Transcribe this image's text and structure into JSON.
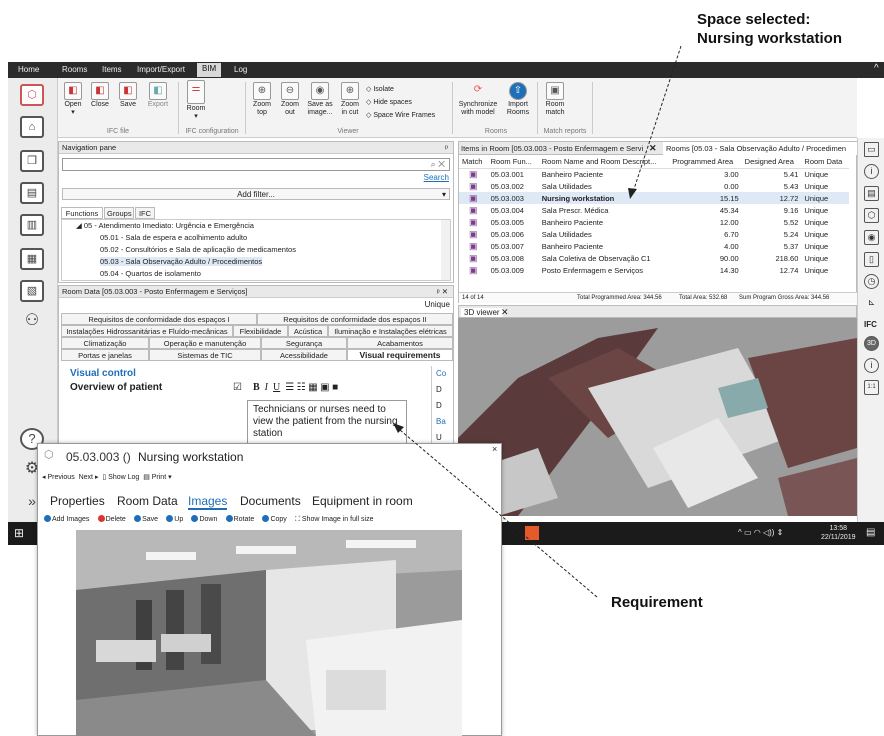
{
  "annotations": {
    "selected_line1": "Space selected:",
    "selected_line2": "Nursing workstation",
    "requirement": "Requirement"
  },
  "menubar": {
    "items": [
      "Home",
      "Rooms",
      "Items",
      "Import/Export",
      "BIM",
      "Log"
    ],
    "active": "BIM",
    "caret": "^"
  },
  "ribbon": {
    "buttons": [
      {
        "label": "Open",
        "sub": "▾"
      },
      {
        "label": "Close"
      },
      {
        "label": "Save"
      },
      {
        "label": "Export"
      },
      {
        "label": "Room",
        "sub": "▾"
      },
      {
        "label": "Zoom",
        "sub": "top"
      },
      {
        "label": "Zoom",
        "sub": "out"
      },
      {
        "label": "Save as",
        "sub": "image..."
      },
      {
        "label": "Zoom",
        "sub": "in cut"
      },
      {
        "label": "Synchronize",
        "sub": "with model"
      },
      {
        "label": "Import",
        "sub": "Rooms"
      },
      {
        "label": "Room",
        "sub": "match"
      }
    ],
    "checks": [
      "Isolate",
      "Hide spaces",
      "Space Wire Frames"
    ],
    "groups": [
      "IFC file",
      "IFC configuration",
      "Viewer",
      "Rooms",
      "Match reports"
    ]
  },
  "nav": {
    "title": "Navigation pane",
    "pin": "ᵖ",
    "search_link": "Search",
    "add_filter": "Add filter...",
    "tabs": [
      "Functions",
      "Groups",
      "IFC"
    ],
    "tree": [
      "05 - Atendimento Imediato: Urgência e Emergência",
      "05.01 - Sala de espera e acolhimento adulto",
      "05.02 - Consultórios e Sala de aplicação de medicamentos",
      "05.03 - Sala Observação Adulto / Procedimentos",
      "05.04 - Quartos de isolamento"
    ]
  },
  "roomdata": {
    "title": "Room Data [05.03.003 - Posto Enfermagem e Serviços]",
    "unique": "Unique",
    "tabs_r1": [
      "Requisitos de conformidade dos espaços I",
      "Requisitos de conformidade dos espaços II"
    ],
    "tabs_r2": [
      "Instalações Hidrossanitárias e Fluído-mecânicas",
      "Flexibilidade",
      "Acústica",
      "Iluminação e Instalações elétricas"
    ],
    "tabs_r3": [
      "Climatização",
      "Operação e manutenção",
      "Segurança",
      "Acabamentos"
    ],
    "tabs_r4": [
      "Portas e janelas",
      "Sistemas de TIC",
      "Acessibilidade",
      "Visual requirements"
    ],
    "section": "Visual control",
    "field": "Overview of patient",
    "editor_text": "Technicians or nurses need to view the patient from the nursing station",
    "side": [
      "Co",
      "D",
      "D",
      "Ba",
      "U"
    ]
  },
  "items_tab": "Items in Room [05.03.003 - Posto Enfermagem e Servi",
  "rooms_tab": "Rooms [05.03 - Sala Observação Adulto / Procedimen",
  "rooms": {
    "headers": [
      "Match",
      "Room Fun...",
      "Room Name and Room Descript...",
      "Programmed Area",
      "Designed Area",
      "Room Data"
    ],
    "rows": [
      [
        "05.03.001",
        "Banheiro Paciente",
        "3.00",
        "5.41",
        "Unique"
      ],
      [
        "05.03.002",
        "Sala Utilidades",
        "0.00",
        "5.43",
        "Unique"
      ],
      [
        "05.03.003",
        "Nursing workstation",
        "15.15",
        "12.72",
        "Unique"
      ],
      [
        "05.03.004",
        "Sala Prescr. Médica",
        "45.34",
        "9.16",
        "Unique"
      ],
      [
        "05.03.005",
        "Banheiro Paciente",
        "12.00",
        "5.52",
        "Unique"
      ],
      [
        "05.03.006",
        "Sala Utilidades",
        "6.70",
        "5.24",
        "Unique"
      ],
      [
        "05.03.007",
        "Banheiro Paciente",
        "4.00",
        "5.37",
        "Unique"
      ],
      [
        "05.03.008",
        "Sala Coletiva de Observação C1",
        "90.00",
        "218.60",
        "Unique"
      ],
      [
        "05.03.009",
        "Posto Enfermagem e Serviços",
        "14.30",
        "12.74",
        "Unique"
      ]
    ],
    "footer": {
      "count": "14 of 14",
      "prog": "Total Programmed Area: 344.56",
      "total": "Total Area: 532.68",
      "gross": "Sum Program Gross Area: 344.56"
    }
  },
  "viewer_tab": "3D viewer",
  "taskbar": {
    "time": "13:58",
    "date": "22/11/2019"
  },
  "rightbar": {
    "ifc": "IFC",
    "badge": "3D"
  },
  "popup": {
    "title": "05.03.003 ()",
    "name": "Nursing workstation",
    "close": "×",
    "prev": "Previous",
    "next": "Next",
    "showlog": "Show Log",
    "print": "Print",
    "tabs": [
      "Properties",
      "Room Data",
      "Images",
      "Documents",
      "Equipment in room"
    ],
    "active_tab": "Images",
    "toolbar": [
      "Add Images",
      "Delete",
      "Save",
      "Up",
      "Down",
      "Rotate",
      "Copy",
      "Show Image in full size"
    ]
  },
  "colors": {
    "accent": "#1e6fb8",
    "dark": "#2b2b2b"
  }
}
